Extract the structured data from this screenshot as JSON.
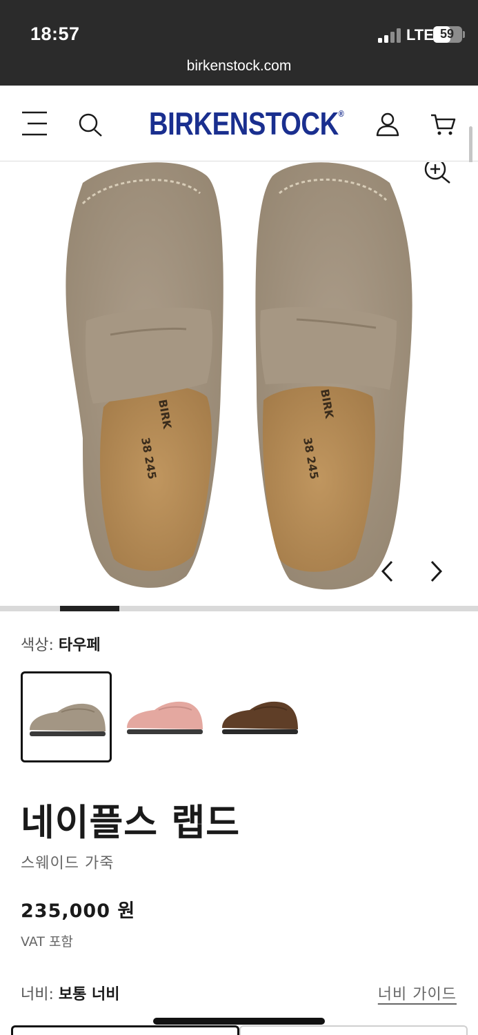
{
  "status_bar": {
    "time": "18:57",
    "network": "LTE",
    "battery": "59",
    "battery_level": 0.59,
    "url": "birkenstock.com"
  },
  "header": {
    "brand": "BIRKENSTOCK",
    "brand_mark": "®",
    "icons": [
      "menu-icon",
      "search-icon",
      "account-icon",
      "cart-icon"
    ]
  },
  "gallery": {
    "icons": [
      "zoom-in-icon",
      "chevron-left-icon",
      "chevron-right-icon"
    ],
    "current_slide": 2,
    "colors": {
      "suede": "#a49583",
      "footbed": "#b58c5a",
      "brand_blue": "#1a2f8f"
    }
  },
  "color": {
    "label": "색상:",
    "value": "타우페",
    "swatches": [
      {
        "color": "#a39684",
        "selected": true
      },
      {
        "color": "#e4a8a0",
        "selected": false
      },
      {
        "color": "#5f3e27",
        "selected": false
      }
    ]
  },
  "product": {
    "name": "네이플스 랩드",
    "material": "스웨이드 가죽",
    "price": "235,000 원",
    "vat": "VAT 포함"
  },
  "width": {
    "label": "너비:",
    "value": "보통 너비",
    "guide": "너비 가이드"
  }
}
